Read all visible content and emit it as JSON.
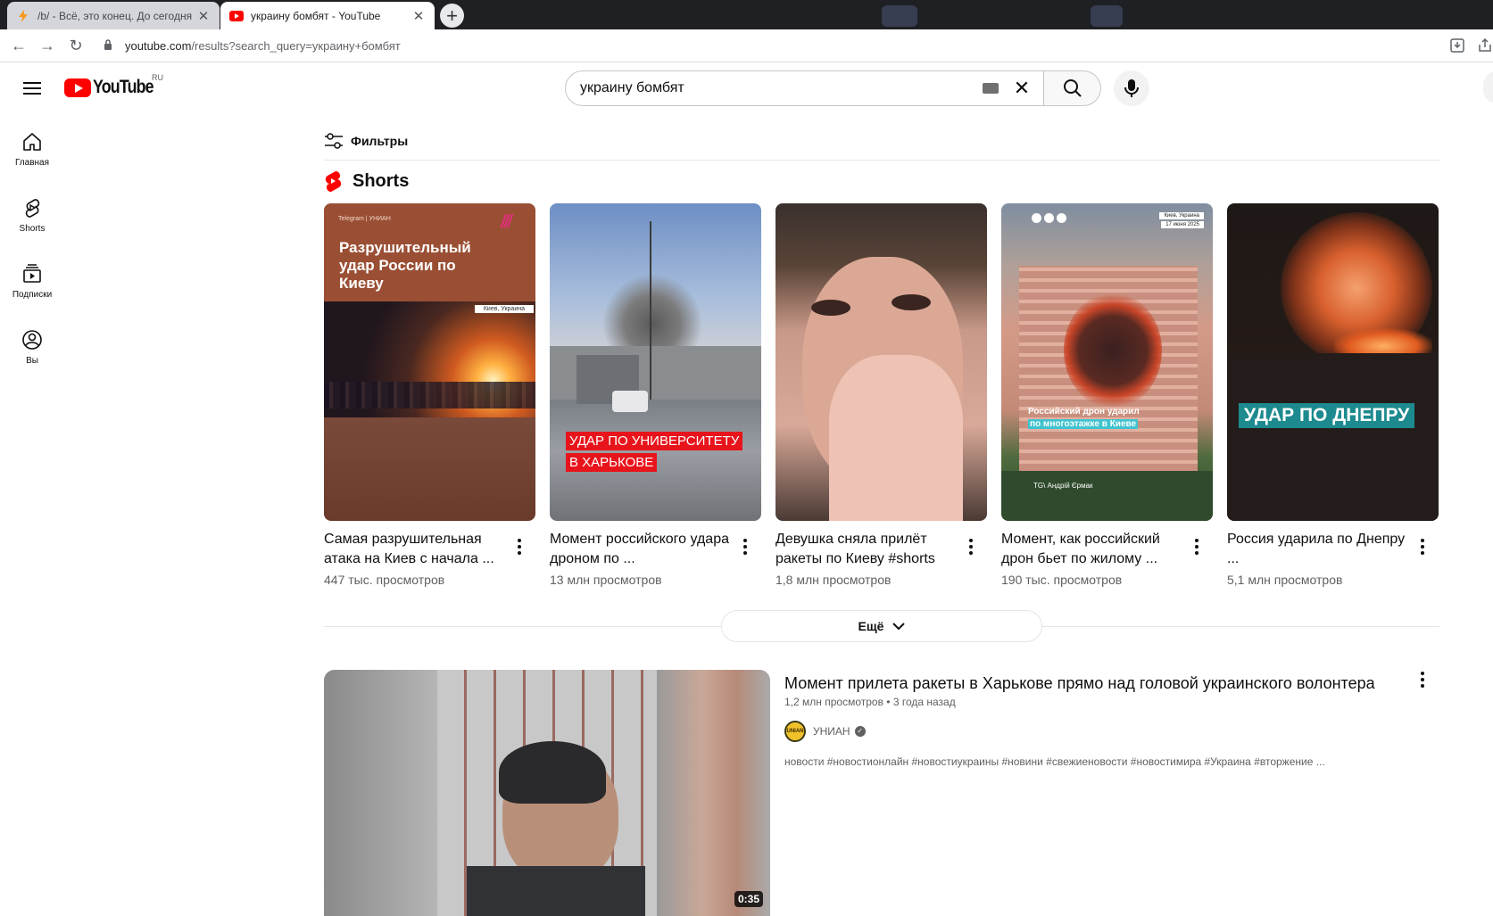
{
  "browser": {
    "tabs": [
      {
        "title": "/b/ - Всё, это конец. До сегодня",
        "active": false
      },
      {
        "title": "украину бомбят - YouTube",
        "active": true
      }
    ],
    "url_host": "youtube.com",
    "url_path": "/results?search_query=украину+бомбят"
  },
  "header": {
    "logo_text": "YouTube",
    "country_code": "RU",
    "search_value": "украину бомбят"
  },
  "sidebar": {
    "items": [
      {
        "label": "Главная",
        "icon": "home-icon"
      },
      {
        "label": "Shorts",
        "icon": "shorts-icon"
      },
      {
        "label": "Подписки",
        "icon": "subscriptions-icon"
      },
      {
        "label": "Вы",
        "icon": "you-icon"
      }
    ]
  },
  "filters": {
    "label": "Фильтры"
  },
  "shorts": {
    "heading": "Shorts",
    "items": [
      {
        "title": "Самая разрушительная атака на Киев с начала ...",
        "views": "447 тыс. просмотров",
        "thumb_caption_top": "Telegram | УНИАН",
        "thumb_caption": "Разрушительный удар России по Киеву",
        "thumb_tag": "Киев, Украина"
      },
      {
        "title": "Момент российского удара дроном по ...",
        "views": "13 млн просмотров",
        "thumb_caption_1": "УДАР ПО УНИВЕРСИТЕТУ",
        "thumb_caption_2": "В ХАРЬКОВЕ"
      },
      {
        "title": "Девушка сняла прилёт ракеты по Киеву #shorts",
        "views": "1,8 млн просмотров"
      },
      {
        "title": "Момент, как российский дрон бьет по жилому ...",
        "views": "190 тыс. просмотров",
        "thumb_loc": "Киев, Украина",
        "thumb_date": "17 июня 2025",
        "thumb_caption_1": "Российский дрон ударил",
        "thumb_caption_2": "по многоэтажке в Киеве",
        "thumb_credit": "TG\\ Андрій Єрмак"
      },
      {
        "title": "Россия ударила по Днепру ...",
        "views": "5,1 млн просмотров",
        "thumb_caption": "УДАР ПО ДНЕПРУ"
      }
    ],
    "more_label": "Ещё"
  },
  "video": {
    "title": "Момент прилета ракеты в Харькове прямо над головой украинского волонтера",
    "views": "1,2 млн просмотров",
    "age": "3 года назад",
    "channel": "УНИАН",
    "description": "новости #новостионлайн #новостиукраины #новини #свежиеновости #новостимира #Украина #вторжение ...",
    "duration": "0:35"
  },
  "colors": {
    "brand_red": "#ff0000",
    "text": "#0f0f0f",
    "secondary": "#606060"
  }
}
